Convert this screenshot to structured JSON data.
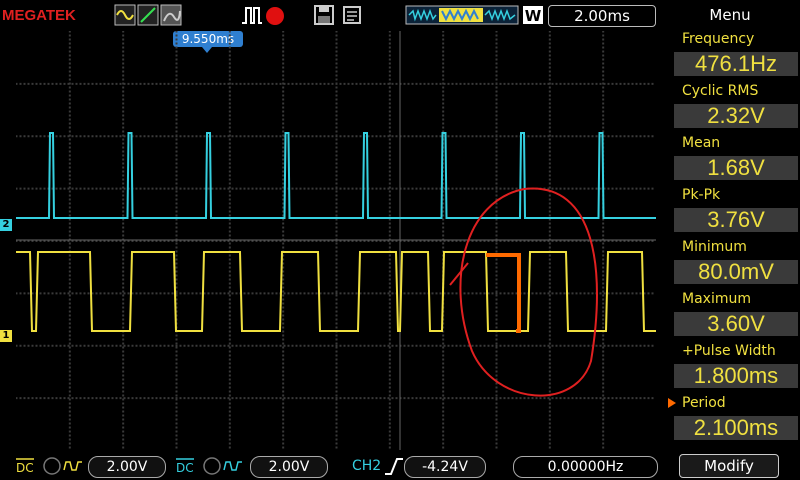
{
  "header": {
    "brand": "MEGATEK",
    "timebase": "2.00ms",
    "menu_label": "Menu",
    "mode_icons": [
      "sine-wave-icon",
      "line-display-icon",
      "persist-icon",
      "pulse-trigger-icon",
      "record-dot-icon",
      "save-disk-icon",
      "print-icon"
    ],
    "memory_icon": "memory-waveform-icon",
    "memory_label": "W"
  },
  "screen": {
    "trigger_marker": "9.550ms",
    "channel_markers": {
      "ch2": "2",
      "ch1": "1"
    }
  },
  "measurements": [
    {
      "label": "Frequency",
      "value": "476.1Hz"
    },
    {
      "label": "Cyclic RMS",
      "value": "2.32V"
    },
    {
      "label": "Mean",
      "value": "1.68V"
    },
    {
      "label": "Pk-Pk",
      "value": "3.76V"
    },
    {
      "label": "Minimum",
      "value": "80.0mV"
    },
    {
      "label": "Maximum",
      "value": "3.60V"
    },
    {
      "label": "+Pulse Width",
      "value": "1.800ms"
    },
    {
      "label": "Period",
      "value": "2.100ms"
    }
  ],
  "footer": {
    "ch1_coupling": "DC",
    "ch1_scale": "2.00V",
    "ch2_coupling": "DC",
    "ch2_scale": "2.00V",
    "trigger_source": "CH2",
    "trigger_level": "-4.24V",
    "frequency_counter": "0.00000Hz",
    "modify_button": "Modify"
  },
  "colors": {
    "ch1": "#f0e040",
    "ch2": "#35d0e0",
    "brand": "#e02020",
    "annotation": "#e02020",
    "highlight": "#ff6a00"
  }
}
